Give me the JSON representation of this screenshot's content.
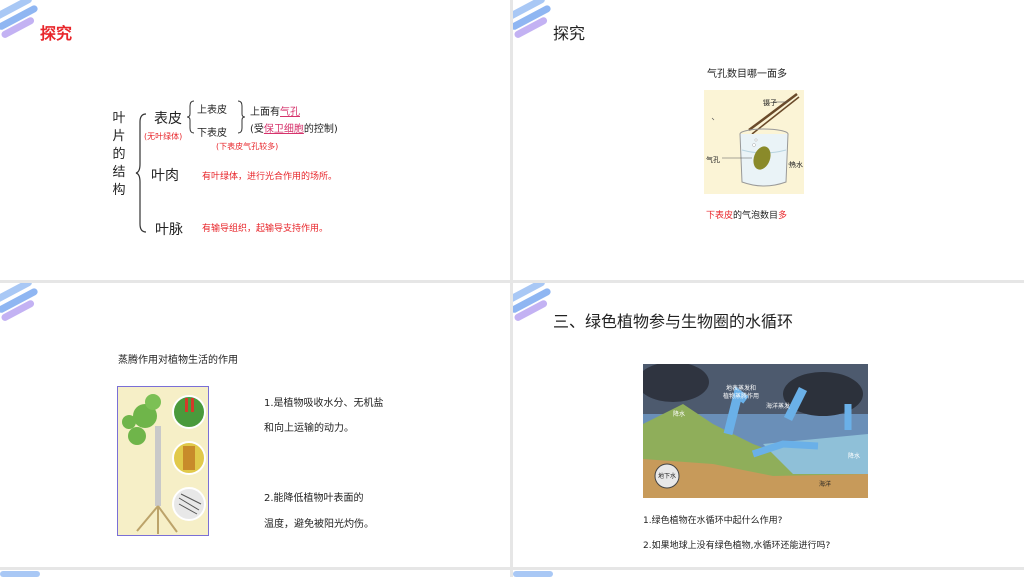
{
  "slides": [
    {
      "title": "探究",
      "vertical_label": [
        "叶",
        "片",
        "的",
        "结",
        "构"
      ],
      "epidermis": "表皮",
      "no_chloroplast": "(无叶绿体)",
      "upper_epidermis": "上表皮",
      "lower_epidermis": "下表皮",
      "has_prefix": "上面有",
      "stomata": "气孔",
      "controlled_open": "(受",
      "guard_cells": "保卫细胞",
      "controlled_close": "的控制)",
      "lower_more_stomata": "(下表皮气孔较多)",
      "mesophyll": "叶肉",
      "mesophyll_desc": "有叶绿体，进行光合作用的场所。",
      "vein": "叶脉",
      "vein_desc": "有输导组织，起输导支持作用。"
    },
    {
      "title": "探究",
      "question": "气孔数目哪一面多",
      "label_tweezers": "镊子",
      "label_stomata": "气孔",
      "label_hot_water": "热水",
      "answer_red1": "下表皮",
      "answer_mid": "的气泡数目",
      "answer_red2": "多"
    },
    {
      "heading": "蒸腾作用对植物生活的作用",
      "point1_line1": "1.是植物吸收水分、无机盐",
      "point1_line2": "和向上运输的动力。",
      "point2_line1": "2.能降低植物叶表面的",
      "point2_line2": "温度，避免被阳光灼伤。"
    },
    {
      "title": "三、绿色植物参与生物圈的水循环",
      "img_label1": "地表蒸发和",
      "img_label2": "植物蒸腾作用",
      "img_label3": "海洋蒸发",
      "img_label4": "降水",
      "img_label5": "降水",
      "img_label6": "地下水",
      "img_label7": "海洋",
      "q1": "1.绿色植物在水循环中起什么作用?",
      "q2": "2.如果地球上没有绿色植物,水循环还能进行吗?"
    }
  ],
  "colors": {
    "red": "#e8262b",
    "pink": "#d6336c",
    "deco_blue": "#5aa8f0",
    "deco_purple": "#b08ef0"
  }
}
